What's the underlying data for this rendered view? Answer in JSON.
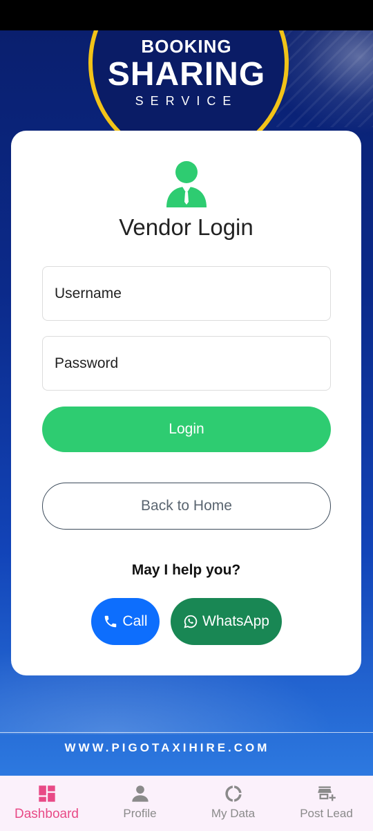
{
  "logo": {
    "line1": "BOOKING",
    "line2": "SHARING",
    "line3": "SERVICE"
  },
  "login": {
    "title": "Vendor Login",
    "username_placeholder": "Username",
    "password_placeholder": "Password",
    "login_label": "Login",
    "back_home_label": "Back to Home"
  },
  "help": {
    "text": "May I help you?",
    "call_label": "Call",
    "whatsapp_label": "WhatsApp"
  },
  "footer": {
    "url": "WWW.PIGOTAXIHIRE.COM"
  },
  "bottom_nav": {
    "items": [
      {
        "label": "Dashboard",
        "icon": "dashboard-icon",
        "active": true
      },
      {
        "label": "Profile",
        "icon": "person-icon",
        "active": false
      },
      {
        "label": "My Data",
        "icon": "donut-icon",
        "active": false
      },
      {
        "label": "Post Lead",
        "icon": "store-add-icon",
        "active": false
      }
    ]
  },
  "colors": {
    "accent_green": "#2ecc71",
    "call_blue": "#0d6efd",
    "whatsapp_green": "#198754",
    "nav_active": "#e84a86",
    "logo_ring": "#f2c318"
  }
}
